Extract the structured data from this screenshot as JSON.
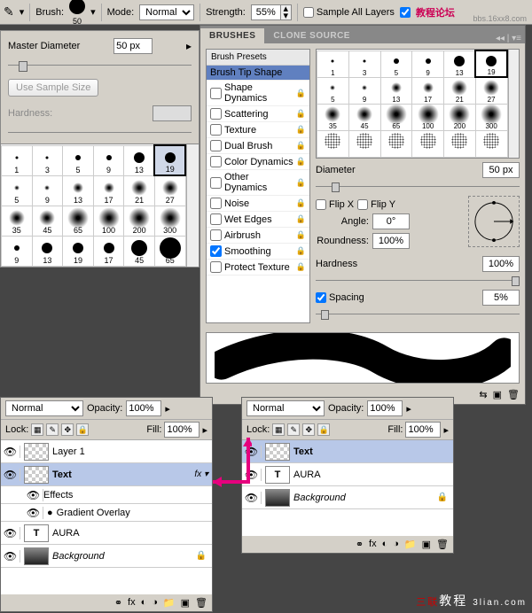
{
  "toolbar": {
    "brush_label": "Brush:",
    "brush_size": "50",
    "mode_label": "Mode:",
    "mode_value": "Normal",
    "strength_label": "Strength:",
    "strength_value": "55%",
    "sample_all": "Sample All Layers",
    "watermark": "教程论坛",
    "watermark_url": "bbs.16xx8.com"
  },
  "left": {
    "master": "Master Diameter",
    "master_val": "50 px",
    "use_sample": "Use Sample Size",
    "hardness": "Hardness:",
    "grid": [
      [
        "1",
        "3",
        "5",
        "9",
        "13",
        "19"
      ],
      [
        "5",
        "9",
        "13",
        "17",
        "21",
        "27"
      ],
      [
        "35",
        "45",
        "65",
        "100",
        "200",
        "300"
      ],
      [
        "9",
        "13",
        "19",
        "17",
        "45",
        "65"
      ]
    ]
  },
  "brushes": {
    "tab1": "BRUSHES",
    "tab2": "CLONE SOURCE",
    "presets": "Brush Presets",
    "tip": "Brush Tip Shape",
    "items": [
      {
        "label": "Shape Dynamics",
        "chk": false,
        "lock": true
      },
      {
        "label": "Scattering",
        "chk": false,
        "lock": true
      },
      {
        "label": "Texture",
        "chk": false,
        "dis": true,
        "lock": true
      },
      {
        "label": "Dual Brush",
        "chk": false,
        "dis": true,
        "lock": true
      },
      {
        "label": "Color Dynamics",
        "chk": false,
        "dis": true,
        "lock": true
      },
      {
        "label": "Other Dynamics",
        "chk": false,
        "lock": true
      },
      {
        "label": "Noise",
        "chk": false,
        "lock": true
      },
      {
        "label": "Wet Edges",
        "chk": false,
        "dis": true,
        "lock": true
      },
      {
        "label": "Airbrush",
        "chk": false,
        "dis": true,
        "lock": true
      },
      {
        "label": "Smoothing",
        "chk": true,
        "lock": true
      },
      {
        "label": "Protect Texture",
        "chk": false,
        "dis": true,
        "lock": true
      }
    ],
    "grid": [
      [
        "1",
        "3",
        "5",
        "9",
        "13",
        "19"
      ],
      [
        "5",
        "9",
        "13",
        "17",
        "21",
        "27"
      ],
      [
        "35",
        "45",
        "65",
        "100",
        "200",
        "300"
      ],
      [
        "",
        "",
        "",
        "",
        "",
        ""
      ]
    ],
    "diameter": "Diameter",
    "diameter_val": "50 px",
    "flipx": "Flip X",
    "flipy": "Flip Y",
    "angle": "Angle:",
    "angle_val": "0°",
    "round": "Roundness:",
    "round_val": "100%",
    "hardness": "Hardness",
    "hardness_val": "100%",
    "spacing": "Spacing",
    "spacing_val": "5%"
  },
  "layersA": {
    "blend": "Normal",
    "opacity_lbl": "Opacity:",
    "opacity": "100%",
    "lock": "Lock:",
    "fill_lbl": "Fill:",
    "fill": "100%",
    "rows": [
      {
        "name": "Layer 1",
        "thumb": "checker"
      },
      {
        "name": "Text",
        "thumb": "checker",
        "fx": "fx",
        "sel": true
      },
      {
        "name": "Effects",
        "sub": true
      },
      {
        "name": "Gradient Overlay",
        "sub": true,
        "icon": "grad"
      },
      {
        "name": "AURA",
        "thumb": "T"
      },
      {
        "name": "Background",
        "thumb": "grad",
        "italic": true,
        "lock": true
      }
    ]
  },
  "layersB": {
    "blend": "Normal",
    "opacity_lbl": "Opacity:",
    "opacity": "100%",
    "lock": "Lock:",
    "fill_lbl": "Fill:",
    "fill": "100%",
    "rows": [
      {
        "name": "Text",
        "thumb": "checker",
        "sel": true
      },
      {
        "name": "AURA",
        "thumb": "T"
      },
      {
        "name": "Background",
        "thumb": "grad",
        "italic": true,
        "lock": true
      }
    ]
  },
  "footer": "3lian.com"
}
